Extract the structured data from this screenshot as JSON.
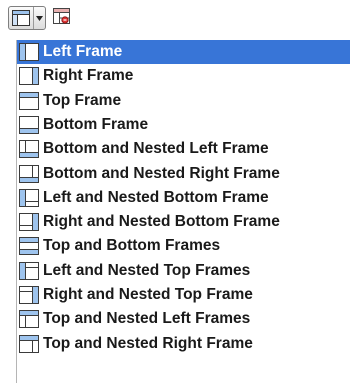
{
  "toolbar": {
    "frame_layout_button": "frame-layout-icon",
    "dropdown_arrow": "chevron-down-icon",
    "frame_properties_button": "frame-properties-icon"
  },
  "menu": {
    "selected_index": 0,
    "items": [
      {
        "label": "Left Frame",
        "icon": "frame-left-icon"
      },
      {
        "label": "Right Frame",
        "icon": "frame-right-icon"
      },
      {
        "label": "Top Frame",
        "icon": "frame-top-icon"
      },
      {
        "label": "Bottom Frame",
        "icon": "frame-bottom-icon"
      },
      {
        "label": "Bottom and Nested Left Frame",
        "icon": "frame-bottom-nested-left-icon"
      },
      {
        "label": "Bottom and Nested Right Frame",
        "icon": "frame-bottom-nested-right-icon"
      },
      {
        "label": "Left and Nested Bottom Frame",
        "icon": "frame-left-nested-bottom-icon"
      },
      {
        "label": "Right and Nested Bottom Frame",
        "icon": "frame-right-nested-bottom-icon"
      },
      {
        "label": "Top and Bottom Frames",
        "icon": "frame-top-bottom-icon"
      },
      {
        "label": "Left and Nested Top Frames",
        "icon": "frame-left-nested-top-icon"
      },
      {
        "label": "Right and Nested Top Frame",
        "icon": "frame-right-nested-top-icon"
      },
      {
        "label": "Top and Nested Left Frames",
        "icon": "frame-top-nested-left-icon"
      },
      {
        "label": "Top and Nested Right Frame",
        "icon": "frame-top-nested-right-icon"
      }
    ]
  },
  "colors": {
    "selection": "#3875d7",
    "selected_text": "#ffffff",
    "text": "#1a1a1a",
    "frame_fill": "#9ec4ee",
    "frame_outline": "#3b3b3b"
  }
}
